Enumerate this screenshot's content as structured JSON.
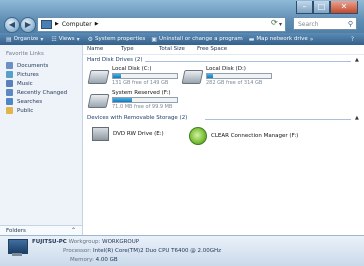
{
  "window": {
    "address": {
      "computer": "Computer"
    },
    "search_placeholder": "Search"
  },
  "toolbar": {
    "organize": "Organize",
    "views": "Views",
    "system_properties": "System properties",
    "uninstall": "Uninstall or change a program",
    "map_drive": "Map network drive"
  },
  "nav": {
    "favorite_links_label": "Favorite Links",
    "items": [
      {
        "label": "Documents",
        "color": "#6b8fc6"
      },
      {
        "label": "Pictures",
        "color": "#58a0c9"
      },
      {
        "label": "Music",
        "color": "#5b7fb8"
      },
      {
        "label": "Recently Changed",
        "color": "#5e88c2"
      },
      {
        "label": "Searches",
        "color": "#4f86c6"
      },
      {
        "label": "Public",
        "color": "#e1b54b"
      }
    ],
    "folders_label": "Folders"
  },
  "columns": [
    "Name",
    "Type",
    "Total Size",
    "Free Space"
  ],
  "hard_disk_group": "Hard Disk Drives (2)",
  "removable_group": "Devices with Removable Storage (2)",
  "drives": [
    {
      "name": "Local Disk (C:)",
      "free_text": "131 GB free of 149 GB",
      "used_fraction": 0.12
    },
    {
      "name": "Local Disk (D:)",
      "free_text": "282 GB free of 314 GB",
      "used_fraction": 0.1
    },
    {
      "name": "System Reserved (F:)",
      "free_text": "71.0 MB free of 99.9 MB",
      "used_fraction": 0.29
    }
  ],
  "removable": [
    {
      "name": "DVD RW Drive (E:)"
    },
    {
      "name": "CLEAR Connection Manager (F:)"
    }
  ],
  "details": {
    "computer_name": "FUJITSU-PC",
    "workgroup_label": "Workgroup:",
    "workgroup": "WORKGROUP",
    "processor_label": "Processor:",
    "processor": "Intel(R) Core(TM)2 Duo CPU     T6400  @ 2.00GHz",
    "memory_label": "Memory:",
    "memory": "4.00 GB"
  },
  "colors": {
    "accent": "#1779b6",
    "titlebar": "#5e8db3",
    "toolbar": "#34608a"
  }
}
